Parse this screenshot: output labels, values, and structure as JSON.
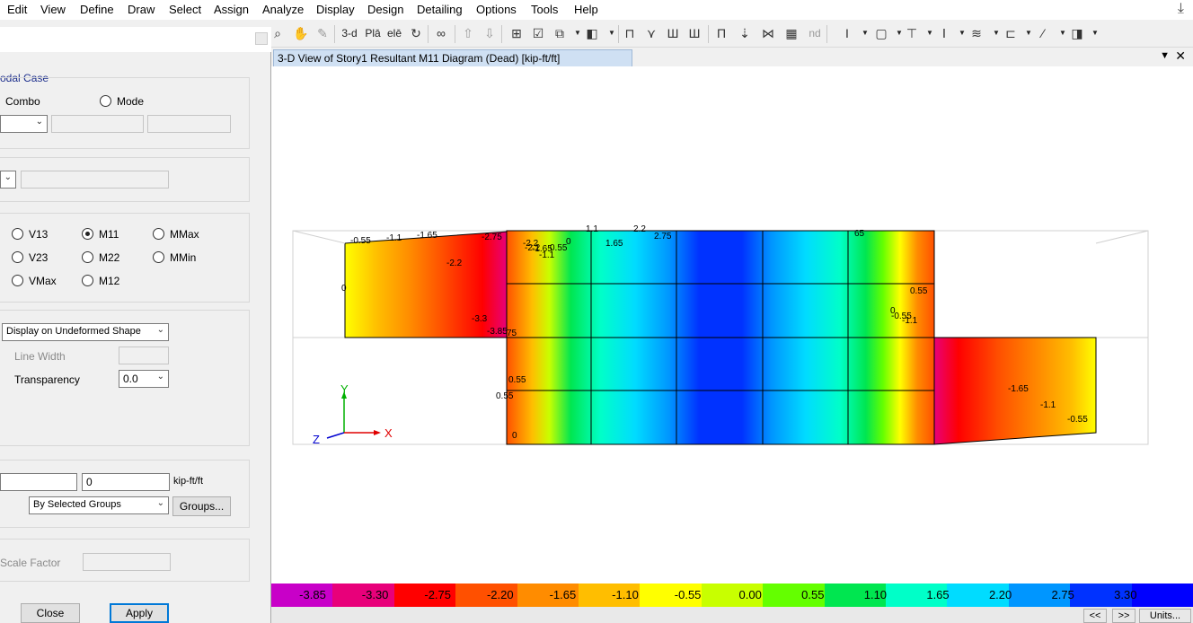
{
  "menu": [
    "Edit",
    "View",
    "Define",
    "Draw",
    "Select",
    "Assign",
    "Analyze",
    "Display",
    "Design",
    "Detailing",
    "Options",
    "Tools",
    "Help"
  ],
  "toolbar": {
    "view_3d": "3-d",
    "view_plan": "Plā",
    "view_elev": "elē",
    "nd": "nd"
  },
  "dialog": {
    "case_group_title": "odal Case",
    "radio_combo": "Combo",
    "radio_mode": "Mode",
    "components": [
      "V13",
      "M11",
      "MMax",
      "V23",
      "M22",
      "MMin",
      "VMax",
      "M12"
    ],
    "selected_component": "M11",
    "display_mode": "Display on Undeformed Shape",
    "line_width_label": "Line Width",
    "transparency_label": "Transparency",
    "transparency_value": "0.0",
    "range_max_value": "0",
    "range_units": "kip-ft/ft",
    "groups_option": "By Selected Groups",
    "groups_button": "Groups...",
    "scale_factor_label": "Scale Factor",
    "close_button": "Close",
    "apply_button": "Apply"
  },
  "view": {
    "tab_title": "3-D View of Story1   Resultant M11 Diagram   (Dead)  [kip-ft/ft]",
    "axis_x": "X",
    "axis_y": "Y",
    "axis_z": "Z",
    "contour_labels": [
      "-0.55",
      "-1.1",
      "-1.65",
      "-2.75",
      "-2.2",
      "-2.2",
      "-1.65",
      "0.55",
      "-1.1",
      "0",
      "1.1",
      "2.2",
      "2.75",
      "1.65",
      "65",
      "-2.2",
      "0",
      "-3.3",
      "-3.85",
      "75",
      "0.55",
      "0",
      "-0.55",
      "-1.1",
      "0.55",
      "0.55",
      "0",
      "-1.65",
      "-1.1",
      "-0.55"
    ]
  },
  "legend": {
    "labels": [
      "-3.85",
      "-3.30",
      "-2.75",
      "-2.20",
      "-1.65",
      "-1.10",
      "-0.55",
      "0.00",
      "0.55",
      "1.10",
      "1.65",
      "2.20",
      "2.75",
      "3.30"
    ],
    "colors": [
      "#c800c8",
      "#e8007a",
      "#ff0000",
      "#ff5000",
      "#ff8c00",
      "#ffbe00",
      "#ffff00",
      "#c8ff00",
      "#64ff00",
      "#00e650",
      "#00ffc8",
      "#00dcff",
      "#0096ff",
      "#0032ff",
      "#0000ff"
    ]
  },
  "status": {
    "prev": "<<",
    "next": ">>",
    "units": "Units..."
  }
}
